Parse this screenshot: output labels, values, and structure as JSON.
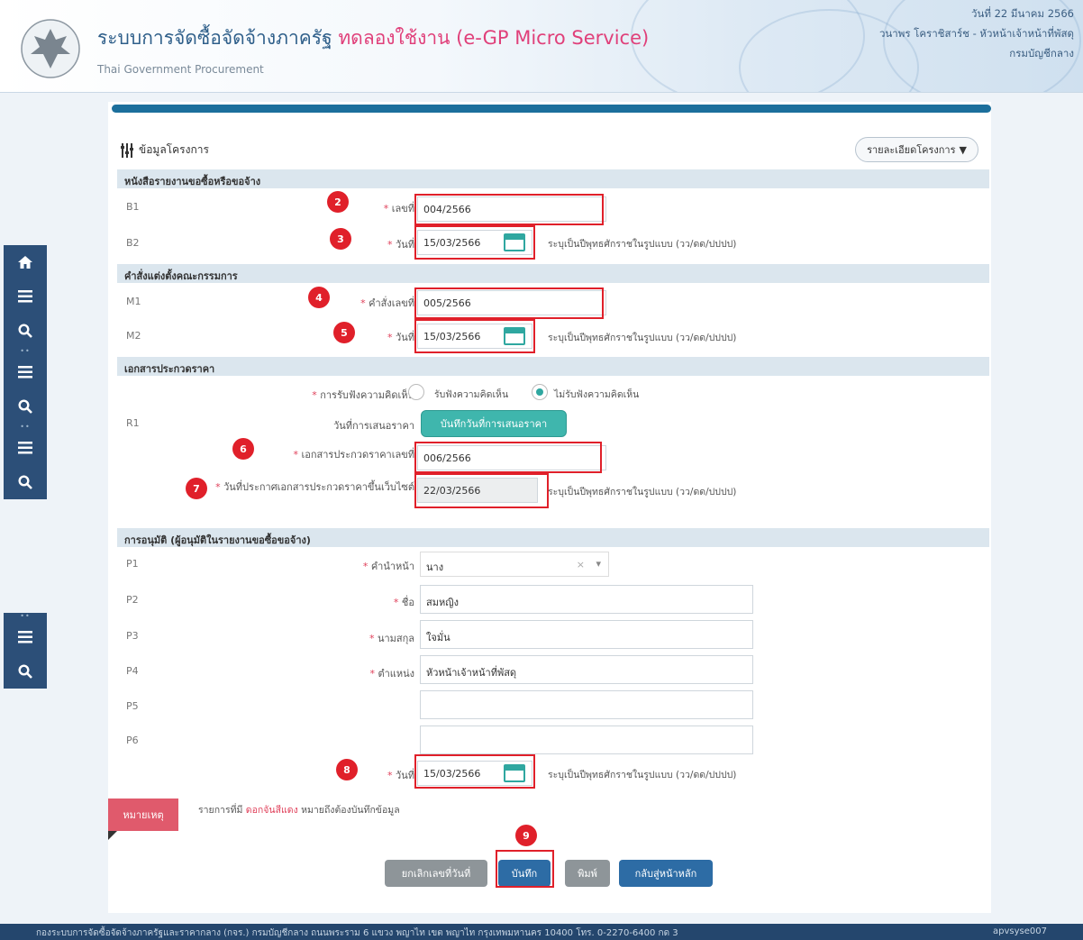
{
  "header": {
    "title_main": "ระบบการจัดซื้อจัดจ้างภาครัฐ",
    "title_trial": "ทดลองใช้งาน (e-GP Micro Service)",
    "subtitle": "Thai Government Procurement",
    "date": "วันที่ 22 มีนาคม 2566",
    "user": "วนาพร โคราชิสาร์ช - หัวหน้าเจ้าหน้าที่พัสดุ",
    "department": "กรมบัญชีกลาง"
  },
  "project": {
    "title": "ข้อมูลโครงการ",
    "detail_button": "รายละเอียดโครงการ"
  },
  "section_b": {
    "heading": "หนังสือรายงานขอซื้อหรือขอจ้าง",
    "b1": {
      "code": "B1",
      "label": "เลขที่",
      "value": "004/2566",
      "badge": "2"
    },
    "b2": {
      "code": "B2",
      "label": "วันที่",
      "value": "15/03/2566",
      "badge": "3",
      "hint": "ระบุเป็นปีพุทธศักราชในรูปแบบ (วว/ดด/ปปปป)"
    }
  },
  "section_m": {
    "heading": "คำสั่งแต่งตั้งคณะกรรมการ",
    "m1": {
      "code": "M1",
      "label": "คำสั่งเลขที่",
      "value": "005/2566",
      "badge": "4"
    },
    "m2": {
      "code": "M2",
      "label": "วันที่",
      "value": "15/03/2566",
      "badge": "5",
      "hint": "ระบุเป็นปีพุทธศักราชในรูปแบบ (วว/ดด/ปปปป)"
    }
  },
  "section_r": {
    "heading": "เอกสารประกวดราคา",
    "comment_label": "การรับฟังความคิดเห็น",
    "radio_accept": "รับฟังความคิดเห็น",
    "radio_reject": "ไม่รับฟังความคิดเห็น",
    "r1": {
      "code": "R1",
      "label": "วันที่การเสนอราคา",
      "button": "บันทึกวันที่การเสนอราคา"
    },
    "doc_no": {
      "label": "เอกสารประกวดราคาเลขที่",
      "value": "006/2566",
      "badge": "6"
    },
    "announce": {
      "label": "วันที่ประกาศเอกสารประกวดราคาขึ้นเว็บไซต์",
      "value": "22/03/2566",
      "badge": "7",
      "hint": "ระบุเป็นปีพุทธศักราชในรูปแบบ (วว/ดด/ปปปป)"
    }
  },
  "section_p": {
    "heading": "การอนุมัติ (ผู้อนุมัติในรายงานขอซื้อขอจ้าง)",
    "p1": {
      "code": "P1",
      "label": "คำนำหน้า",
      "value": "นาง"
    },
    "p2": {
      "code": "P2",
      "label": "ชื่อ",
      "value": "สมหญิง"
    },
    "p3": {
      "code": "P3",
      "label": "นามสกุล",
      "value": "ใจมั่น"
    },
    "p4": {
      "code": "P4",
      "label": "ตำแหน่ง",
      "value": "หัวหน้าเจ้าหน้าที่พัสดุ"
    },
    "p5": {
      "code": "P5",
      "value": ""
    },
    "p6": {
      "code": "P6",
      "value": ""
    },
    "date": {
      "label": "วันที่",
      "value": "15/03/2566",
      "badge": "8",
      "hint": "ระบุเป็นปีพุทธศักราชในรูปแบบ (วว/ดด/ปปปป)"
    }
  },
  "note": {
    "tag": "หมายเหตุ",
    "prefix": "รายการที่มี",
    "highlight": "ดอกจันสีแดง",
    "suffix": "หมายถึงต้องบันทึกข้อมูล"
  },
  "actions": {
    "cancel": "ยกเลิกเลขที่วันที่",
    "save": "บันทึก",
    "save_badge": "9",
    "print": "พิมพ์",
    "back": "กลับสู่หน้าหลัก"
  },
  "footer": {
    "text": "กองระบบการจัดซื้อจัดจ้างภาครัฐและราคากลาง (กจร.) กรมบัญชีกลาง ถนนพระราม 6 แขวง พญาไท เขต พญาไท กรุงเทพมหานคร 10400 โทร. 0-2270-6400 กด 3",
    "code": "apvsyse007"
  },
  "colors": {
    "accent": "#2fa7a0",
    "primary": "#2d6ca5",
    "highlight_red": "#e0202a",
    "sidebar": "#2c4f78"
  }
}
